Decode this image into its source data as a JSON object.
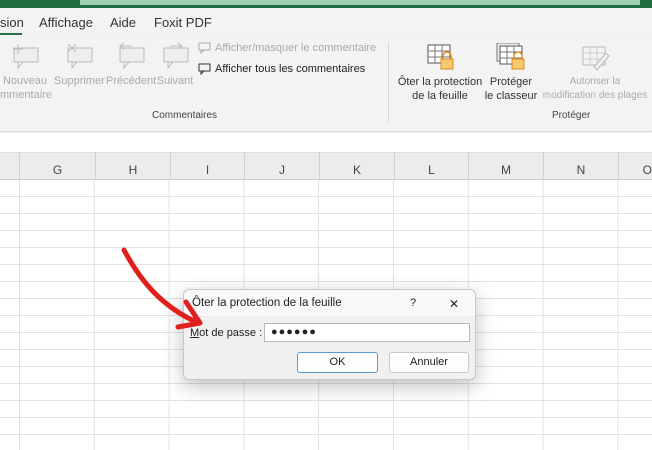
{
  "tabs": [
    {
      "label": "sion",
      "active": true
    },
    {
      "label": "Affichage"
    },
    {
      "label": "Aide"
    },
    {
      "label": "Foxit PDF"
    }
  ],
  "ribbon": {
    "comments": {
      "new_line1": "Nouveau",
      "new_line2": "mmentaire",
      "delete": "Supprimer",
      "previous": "Précédent",
      "next": "Suivant",
      "show_hide": "Afficher/masquer le commentaire",
      "show_all": "Afficher tous les commentaires",
      "group": "Commentaires"
    },
    "protect": {
      "unprotect_line1": "Ôter la protection",
      "unprotect_line2": "de la feuille",
      "protect_wb_line1": "Protéger",
      "protect_wb_line2": "le classeur",
      "allow_line1": "Autoriser la",
      "allow_line2": "modification des plages",
      "group": "Protéger"
    }
  },
  "columns": [
    "G",
    "H",
    "I",
    "J",
    "K",
    "L",
    "M",
    "N",
    "O"
  ],
  "dialog": {
    "title": "Ôter la protection de la feuille",
    "help": "?",
    "close": "✕",
    "label_accel": "M",
    "label_rest": "ot de passe :",
    "password": "●●●●●●",
    "ok": "OK",
    "cancel": "Annuler"
  },
  "colors": {
    "accent": "#217346",
    "annotation": "#e0201c",
    "lock": "#f0a030"
  }
}
